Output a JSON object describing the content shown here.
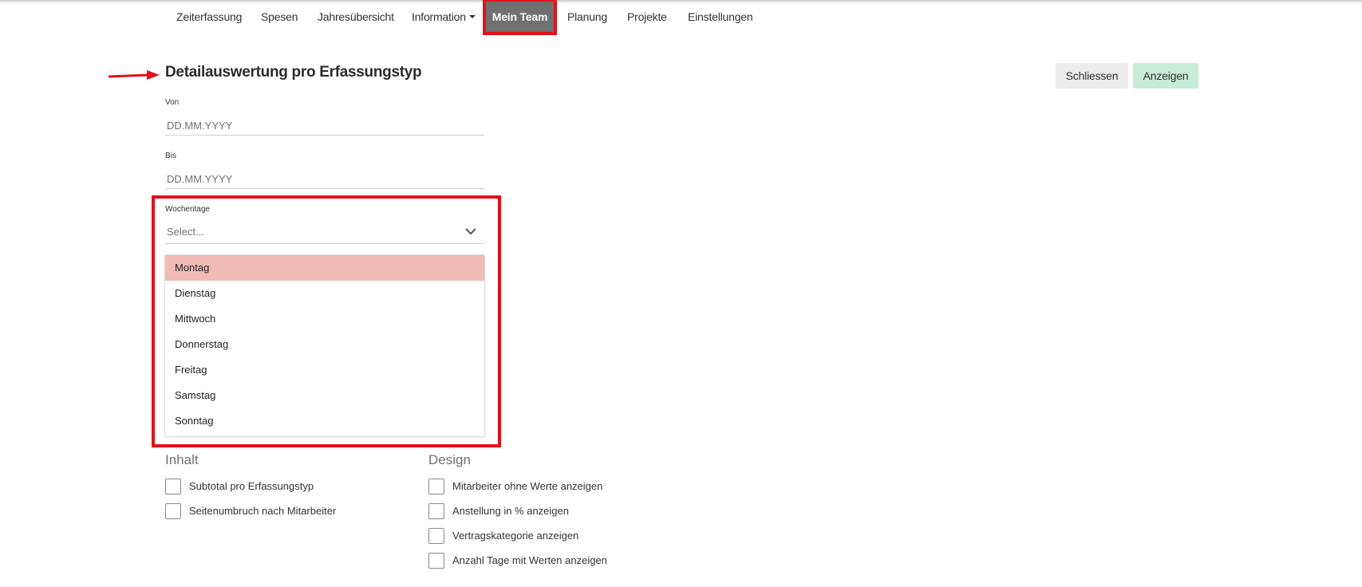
{
  "nav": {
    "items": [
      {
        "label": "Zeiterfassung"
      },
      {
        "label": "Spesen"
      },
      {
        "label": "Jahresübersicht"
      },
      {
        "label": "Information"
      },
      {
        "label": "Mein Team",
        "active": true
      },
      {
        "label": "Planung"
      },
      {
        "label": "Projekte"
      },
      {
        "label": "Einstellungen"
      }
    ]
  },
  "page": {
    "title": "Detailauswertung pro Erfassungstyp",
    "close_button": "Schliessen",
    "show_button": "Anzeigen"
  },
  "form": {
    "from": {
      "label": "Von",
      "placeholder": "DD.MM.YYYY",
      "value": ""
    },
    "to": {
      "label": "Bis",
      "placeholder": "DD.MM.YYYY",
      "value": ""
    },
    "weekdays": {
      "label": "Wochentage",
      "placeholder": "Select...",
      "options": [
        "Montag",
        "Dienstag",
        "Mittwoch",
        "Donnerstag",
        "Freitag",
        "Samstag",
        "Sonntag"
      ],
      "highlighted": "Montag"
    }
  },
  "content_section": {
    "title": "Inhalt",
    "options": [
      {
        "label": "Subtotal pro Erfassungstyp",
        "checked": false
      },
      {
        "label": "Seitenumbruch nach Mitarbeiter",
        "checked": false
      }
    ]
  },
  "design_section": {
    "title": "Design",
    "options": [
      {
        "label": "Mitarbeiter ohne Werte anzeigen",
        "checked": false
      },
      {
        "label": "Anstellung in % anzeigen",
        "checked": false
      },
      {
        "label": "Vertragskategorie anzeigen",
        "checked": false
      },
      {
        "label": "Anzahl Tage mit Werten anzeigen",
        "checked": false
      }
    ]
  },
  "colors": {
    "highlight_frame": "#e2101b",
    "nav_active_bg": "#707070",
    "option_hover": "#f1bbb6",
    "show_button_bg": "#c7ebd7",
    "close_button_bg": "#ececec"
  }
}
